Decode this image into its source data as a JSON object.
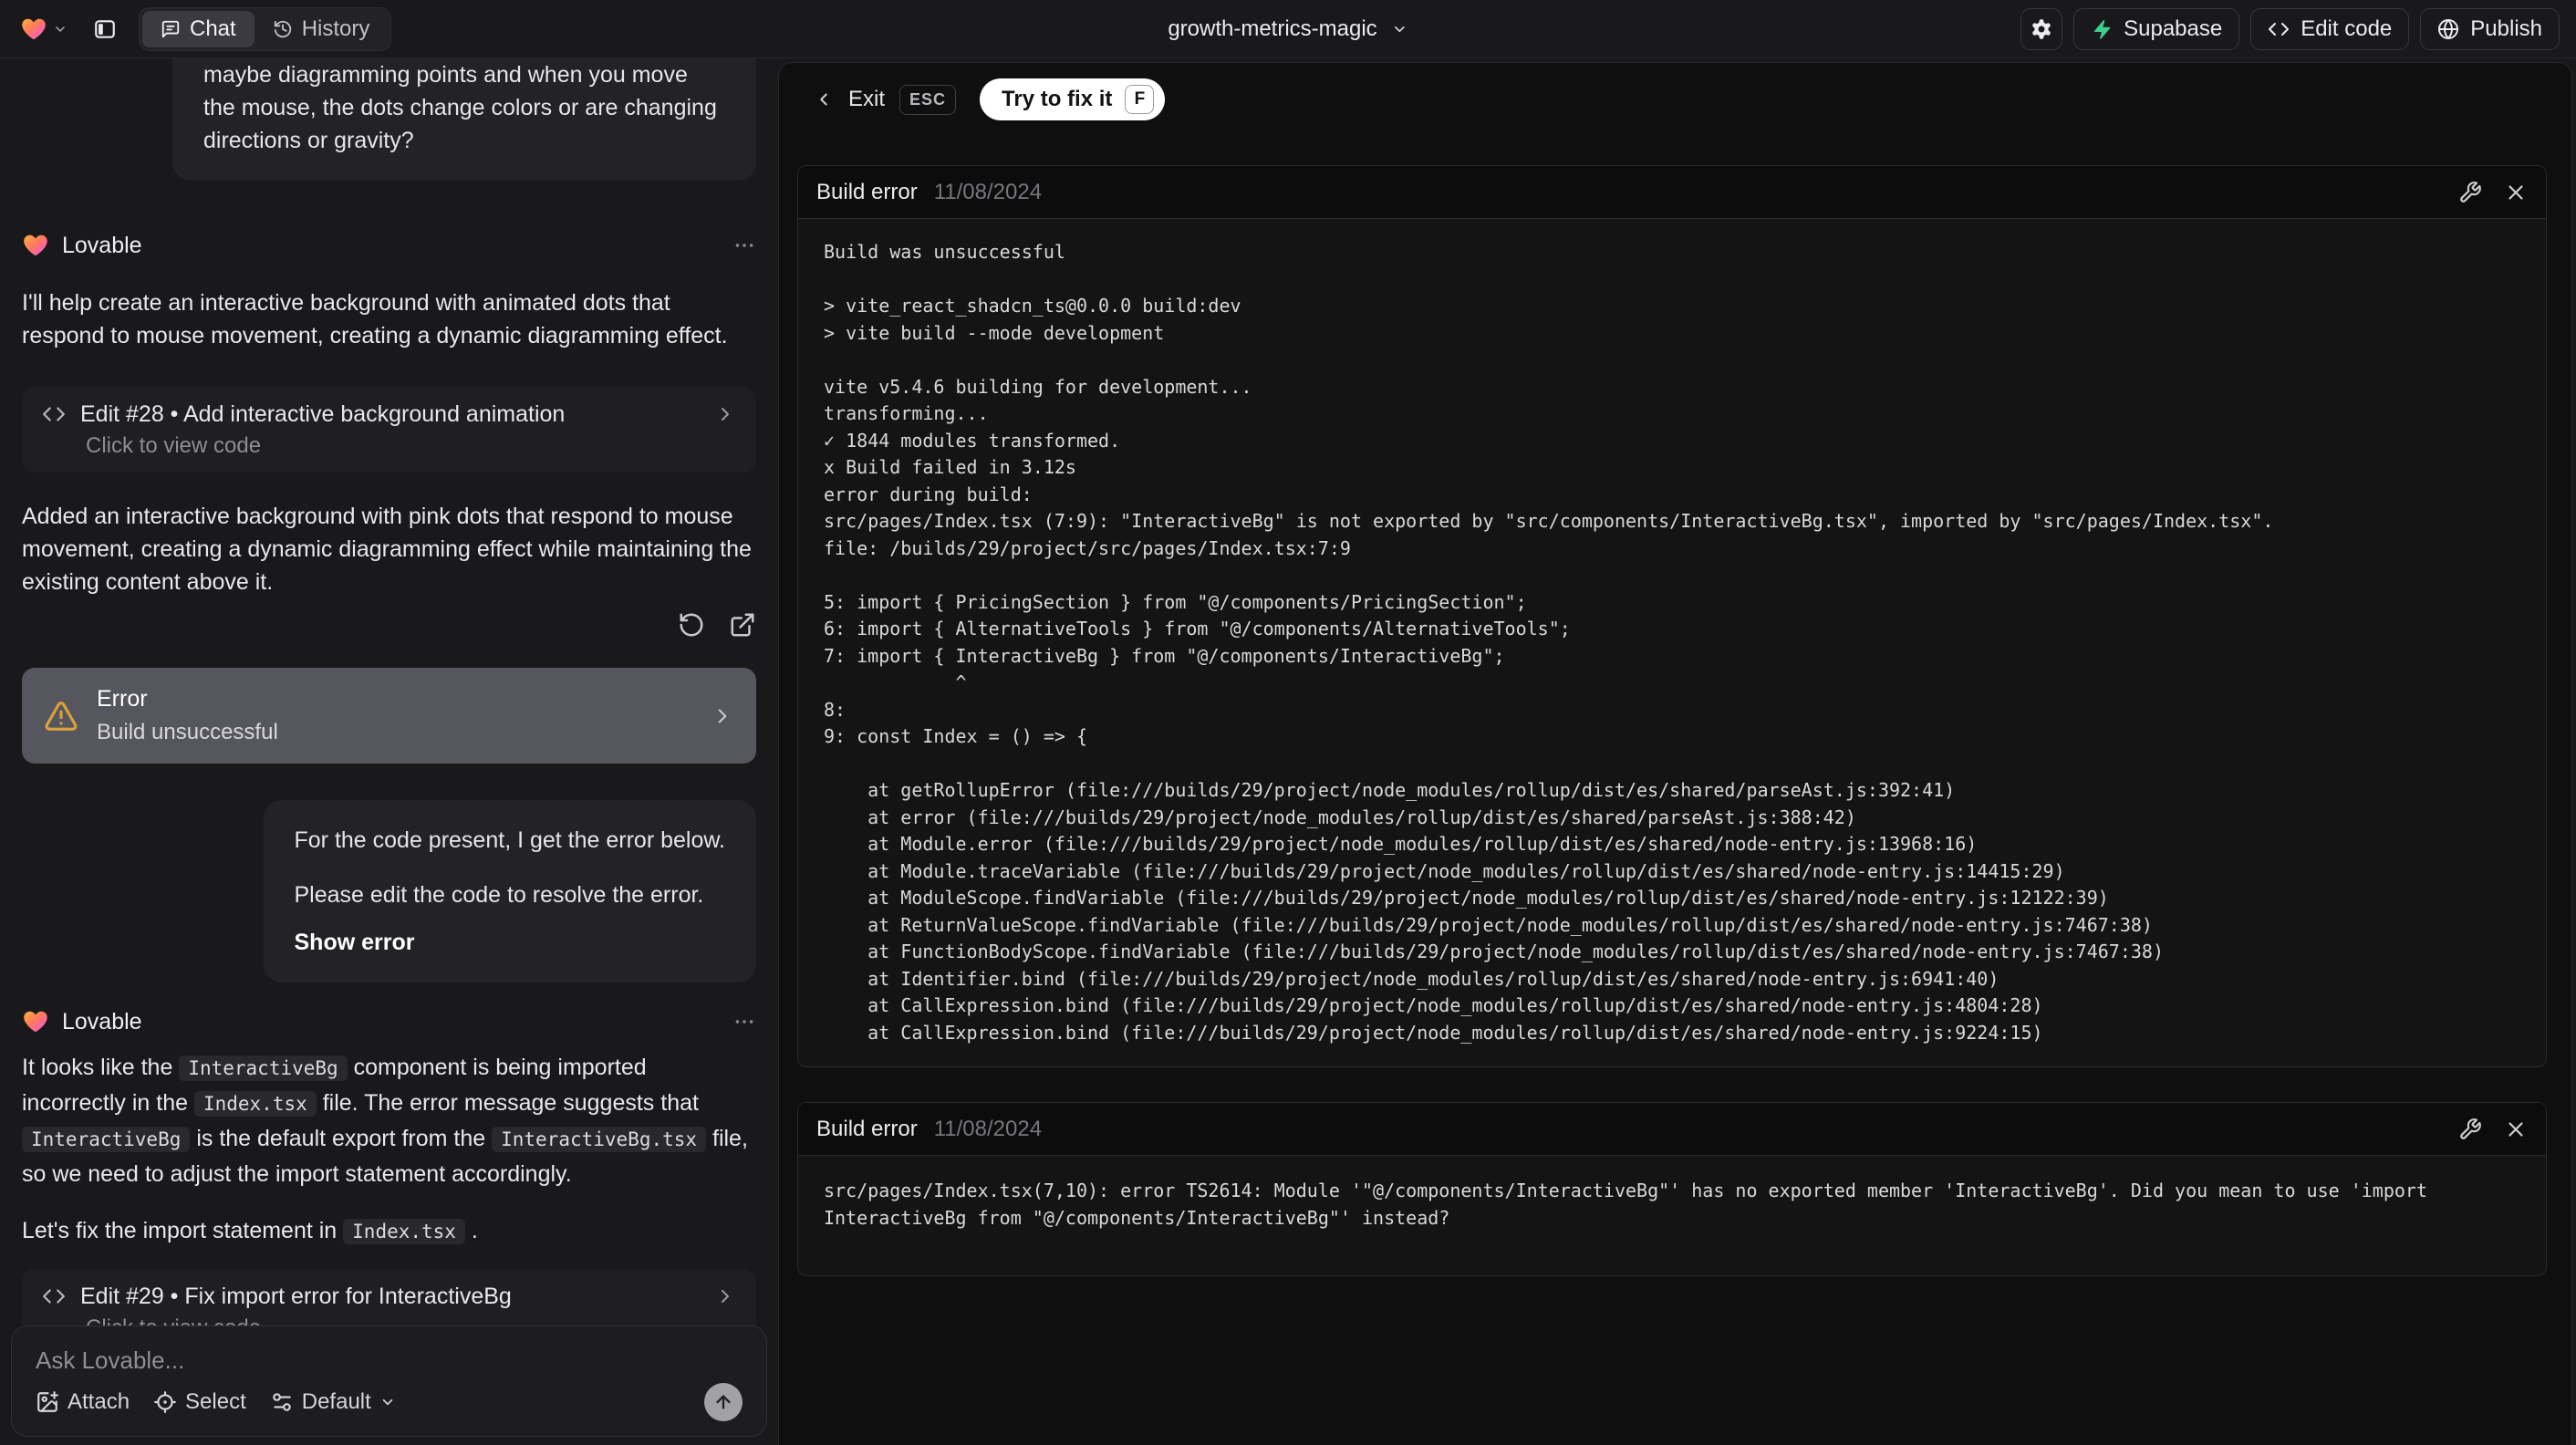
{
  "topbar": {
    "tabs": {
      "chat": "Chat",
      "history": "History"
    },
    "project_name": "growth-metrics-magic",
    "actions": {
      "supabase": "Supabase",
      "edit_code": "Edit code",
      "publish": "Publish"
    }
  },
  "icons": {
    "lovable-logo-icon": "gradient-heart",
    "sidebar-toggle-icon": "panel-left",
    "chat-bubble-icon": "message-square",
    "history-icon": "clock-ccw",
    "gear-icon": "settings-gear",
    "supabase-icon": "green-bolt",
    "code-icon": "angle-brackets",
    "globe-icon": "globe",
    "warning-icon": "amber-triangle-exclamation",
    "restore-icon": "rotate-ccw-arrow",
    "open-preview-icon": "external-link",
    "more-icon": "ellipsis",
    "wrench-icon": "wrench",
    "close-icon": "x",
    "attach-icon": "image-plus",
    "select-icon": "crosshair-target",
    "model-icon": "sliders",
    "send-icon": "arrow-up"
  },
  "chat": {
    "assistant_name": "Lovable",
    "user_message_1": "maybe diagramming points and when you move the mouse, the dots change colors or are changing directions or gravity?",
    "msg1_para1": "I'll help create an interactive background with animated dots that respond to mouse movement, creating a dynamic diagramming effect.",
    "edit28": {
      "title": "Edit #28 • Add interactive background animation",
      "subtitle": "Click to view code"
    },
    "msg1_para2": "Added an interactive background with pink dots that respond to mouse movement, creating a dynamic diagramming effect while maintaining the existing content above it.",
    "error_card": {
      "title": "Error",
      "subtitle": "Build unsuccessful"
    },
    "user_message_2": {
      "line1": "For the code present, I get the error below.",
      "line2": "Please edit the code to resolve the error.",
      "action": "Show error"
    },
    "msg2_para1_segments": [
      {
        "text": "It looks like the "
      },
      {
        "code": "InteractiveBg"
      },
      {
        "text": " component is being imported incorrectly in the "
      },
      {
        "code": "Index.tsx"
      },
      {
        "text": " file. The error message suggests that "
      },
      {
        "code": "InteractiveBg"
      },
      {
        "text": " is the default export from the "
      },
      {
        "code": "InteractiveBg.tsx"
      },
      {
        "text": " file, so we need to adjust the import statement accordingly."
      }
    ],
    "msg2_para2_segments": [
      {
        "text": "Let's fix the import statement in "
      },
      {
        "code": "Index.tsx"
      },
      {
        "text": " ."
      }
    ],
    "edit29": {
      "title": "Edit #29 • Fix import error for InteractiveBg",
      "subtitle": "Click to view code"
    },
    "composer": {
      "placeholder": "Ask Lovable...",
      "attach": "Attach",
      "select": "Select",
      "model": "Default"
    }
  },
  "overlay": {
    "exit_label": "Exit",
    "esc_key": "ESC",
    "fix_label": "Try to fix it",
    "fix_key": "F",
    "panel1": {
      "title": "Build error",
      "date": "11/08/2024",
      "log": [
        "Build was unsuccessful",
        "",
        "> vite_react_shadcn_ts@0.0.0 build:dev",
        "> vite build --mode development",
        "",
        "vite v5.4.6 building for development...",
        "transforming...",
        "✓ 1844 modules transformed.",
        "x Build failed in 3.12s",
        "error during build:",
        "src/pages/Index.tsx (7:9): \"InteractiveBg\" is not exported by \"src/components/InteractiveBg.tsx\", imported by \"src/pages/Index.tsx\".",
        "file: /builds/29/project/src/pages/Index.tsx:7:9",
        "",
        "5: import { PricingSection } from \"@/components/PricingSection\";",
        "6: import { AlternativeTools } from \"@/components/AlternativeTools\";",
        "7: import { InteractiveBg } from \"@/components/InteractiveBg\";",
        "            ^",
        "8:",
        "9: const Index = () => {",
        "",
        "    at getRollupError (file:///builds/29/project/node_modules/rollup/dist/es/shared/parseAst.js:392:41)",
        "    at error (file:///builds/29/project/node_modules/rollup/dist/es/shared/parseAst.js:388:42)",
        "    at Module.error (file:///builds/29/project/node_modules/rollup/dist/es/shared/node-entry.js:13968:16)",
        "    at Module.traceVariable (file:///builds/29/project/node_modules/rollup/dist/es/shared/node-entry.js:14415:29)",
        "    at ModuleScope.findVariable (file:///builds/29/project/node_modules/rollup/dist/es/shared/node-entry.js:12122:39)",
        "    at ReturnValueScope.findVariable (file:///builds/29/project/node_modules/rollup/dist/es/shared/node-entry.js:7467:38)",
        "    at FunctionBodyScope.findVariable (file:///builds/29/project/node_modules/rollup/dist/es/shared/node-entry.js:7467:38)",
        "    at Identifier.bind (file:///builds/29/project/node_modules/rollup/dist/es/shared/node-entry.js:6941:40)",
        "    at CallExpression.bind (file:///builds/29/project/node_modules/rollup/dist/es/shared/node-entry.js:4804:28)",
        "    at CallExpression.bind (file:///builds/29/project/node_modules/rollup/dist/es/shared/node-entry.js:9224:15)"
      ]
    },
    "panel2": {
      "title": "Build error",
      "date": "11/08/2024",
      "log": [
        "src/pages/Index.tsx(7,10): error TS2614: Module '\"@/components/InteractiveBg\"' has no exported member 'InteractiveBg'. Did you mean to use 'import",
        "InteractiveBg from \"@/components/InteractiveBg\"' instead?"
      ]
    }
  },
  "colors": {
    "supabase_green": "#3ecf8e",
    "warning_amber": "#dca03c"
  }
}
